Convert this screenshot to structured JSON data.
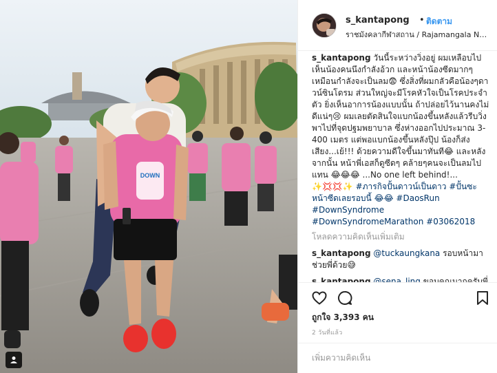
{
  "post": {
    "username": "s_kantapong",
    "separator": "•",
    "follow_label": "ติดตาม",
    "location": "ราชมังคลากีฬาสถาน / Rajamangala National Stadium",
    "caption": {
      "username": "s_kantapong",
      "text": "วันนี้ระหว่างวิ่งอยู่ ผมเหลือบไปเห็นน้องคนนึงกำลังอ้วก และหน้าน้องซีดมากๆ เหมือนกำลังจะเป็นลม😨 ซึ่งสิ่งที่ผมกลัวคือน้องๆดาวน์ซินโดรม ส่วนใหญ่จะมีโรคหัวใจเป็นโรคประจำตัว ยิ่งเห็นอาการน้องแบบนั้น ถ้าปล่อยไว้นานคงไม่ดีแน่ๆ😢 ผมเลยตัดสินใจแบกน้องขึ้นหลังแล้วรีบวิ่งพาไปที่จุดปฐมพยาบาล ซึ่งห่างออกไปประมาณ 3-400 เมตร แต่พอแบกน้องขึ้นหลังปุ๊ป น้องก็ส่งเสียง...เย้!!! ด้วยความดีใจขึ้นมาทันที😂 และหลังจากนั้น หน้าพี่เอสก็ดูซีดๆ คล้ายๆคนจะเป็นลมไปแทน 😂😂😂 ...No one left behind!... ✨💢💢✨ ",
      "tags": "#ภารกิจปั้นดาวน์เป็นดาว #ปั้นซะหน้าซีดเลยรอบนี้ 😂😂 #DaosRun #DownSyndrome #DownSyndromeMarathon #03062018"
    },
    "load_more_label": "โหลดความคิดเห็นเพิ่มเติม",
    "comments": [
      {
        "username": "s_kantapong",
        "mention": "@tuckaungkana",
        "text": " รอบหน้ามาช่วยพี่ด้วย😅"
      },
      {
        "username": "s_kantapong",
        "mention": "@sena_ling",
        "text": " ขอบคุณมากครับพี่"
      }
    ],
    "likes_prefix": "ถูกใจ",
    "likes_count": "3,393",
    "likes_suffix": "คน",
    "timestamp": "2 วันที่แล้ว",
    "comment_placeholder": "เพิ่มความคิดเห็น"
  },
  "icons": {
    "like": "heart-outline-icon",
    "comment": "speech-bubble-icon",
    "save": "bookmark-icon",
    "user_tag": "person-icon"
  },
  "colors": {
    "link": "#3897f0",
    "shirt_pink": "#e86aa8",
    "shoes_red": "#e8322e"
  }
}
